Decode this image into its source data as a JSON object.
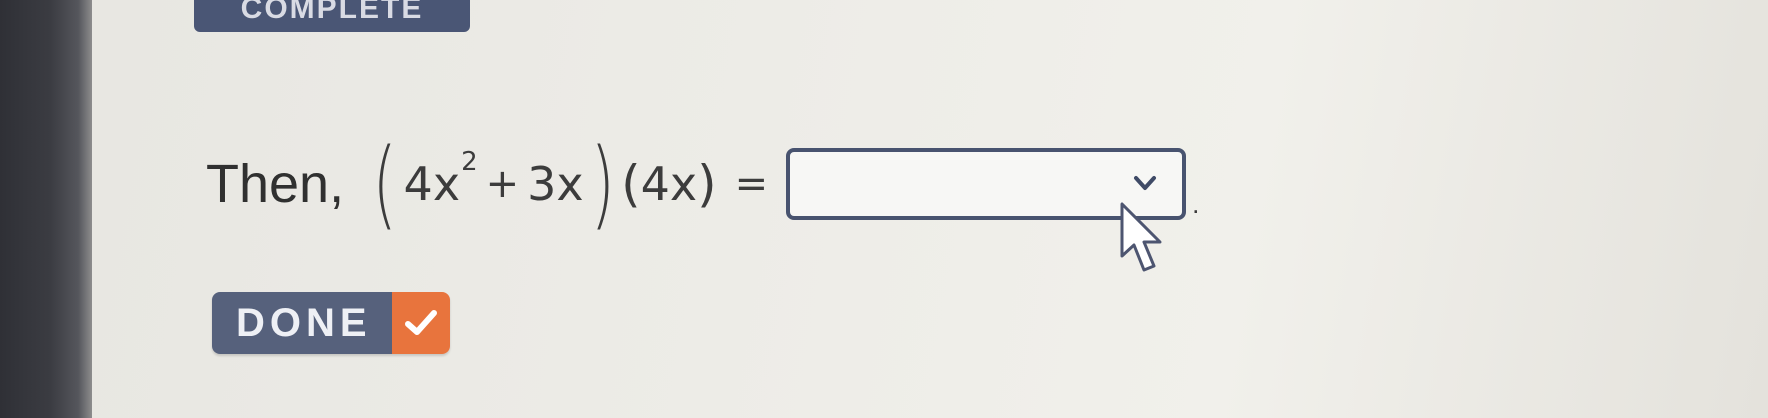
{
  "header": {
    "badge_label": "COMPLETE"
  },
  "question": {
    "lead": "Then,",
    "expression": {
      "open_paren": "(",
      "term1_coeff": "4",
      "term1_var": "x",
      "term1_exp": "2",
      "plus": "+",
      "term2": "3x",
      "close_paren": ")",
      "factor_open": "(",
      "factor": "4x",
      "factor_close": ")",
      "equals": "="
    },
    "answer": {
      "value": "",
      "chevron_icon": "chevron-down-icon"
    },
    "trailing": "."
  },
  "actions": {
    "done_label": "DONE",
    "done_icon": "checkmark-icon"
  },
  "colors": {
    "accent_navy": "#4a5675",
    "accent_orange": "#e8743d"
  }
}
